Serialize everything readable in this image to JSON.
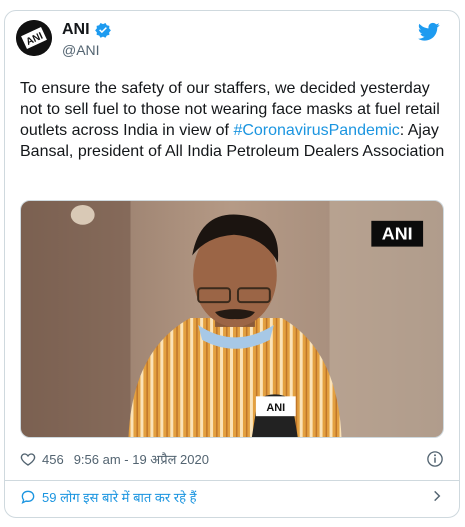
{
  "tweet": {
    "display_name": "ANI",
    "handle": "@ANI",
    "text_before": "To ensure the safety of our staffers, we decided yesterday not to sell fuel to those not wearing face masks at fuel retail outlets across India in view of ",
    "hashtag": "#CoronavirusPandemic",
    "text_after": ": Ajay Bansal, president of All India Petroleum Dealers Association",
    "media_watermark": "ANI",
    "like_count": "456",
    "timestamp": "9:56 am - 19 अप्रैल 2020",
    "conversation_label": "59 लोग इस बारे में बात कर रहे हैं"
  },
  "colors": {
    "link": "#1b95e0",
    "verified": "#1d9bf0",
    "muted": "#536471",
    "border": "#cfd9de"
  },
  "icons": {
    "brand": "twitter-bird-icon",
    "verified": "verified-badge-icon",
    "like": "heart-icon",
    "info": "info-icon",
    "reply": "speech-bubble-icon",
    "more": "chevron-right-icon"
  }
}
